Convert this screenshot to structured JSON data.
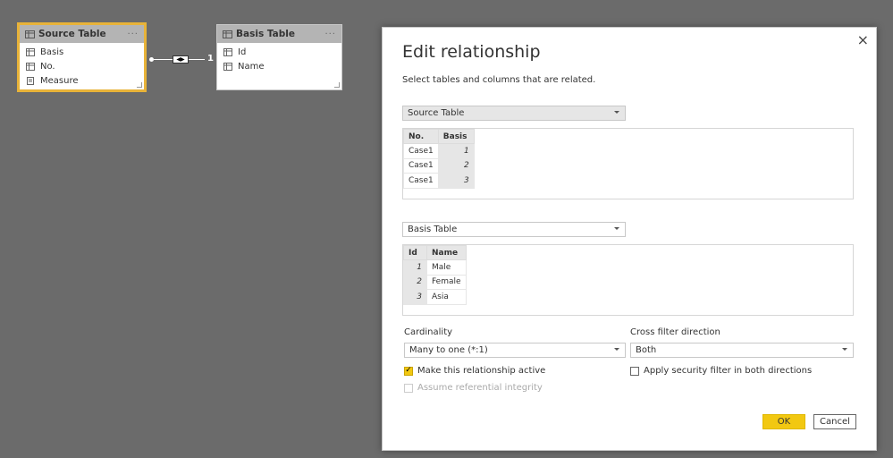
{
  "model": {
    "source_card": {
      "title": "Source Table",
      "more": "···",
      "fields": [
        {
          "label": "Basis",
          "icon": "column-icon"
        },
        {
          "label": "No.",
          "icon": "column-icon"
        },
        {
          "label": "Measure",
          "icon": "measure-icon"
        }
      ]
    },
    "basis_card": {
      "title": "Basis Table",
      "more": "···",
      "fields": [
        {
          "label": "Id",
          "icon": "column-icon"
        },
        {
          "label": "Name",
          "icon": "column-icon"
        }
      ]
    },
    "relationship": {
      "one_side_label": "1",
      "cross_filter_glyph": "◀▶"
    }
  },
  "dialog": {
    "title": "Edit relationship",
    "subtitle": "Select tables and columns that are related.",
    "close": "×",
    "table1": {
      "selected": "Source Table",
      "headers": [
        "No.",
        "Basis"
      ],
      "rows": [
        [
          "Case1",
          "1"
        ],
        [
          "Case1",
          "2"
        ],
        [
          "Case1",
          "3"
        ]
      ]
    },
    "table2": {
      "selected": "Basis Table",
      "headers": [
        "Id",
        "Name"
      ],
      "rows": [
        [
          "1",
          "Male"
        ],
        [
          "2",
          "Female"
        ],
        [
          "3",
          "Asia"
        ]
      ]
    },
    "cardinality": {
      "label": "Cardinality",
      "value": "Many to one (*:1)"
    },
    "cross_filter": {
      "label": "Cross filter direction",
      "value": "Both"
    },
    "make_active": {
      "label": "Make this relationship active",
      "checked": true
    },
    "referential_integrity": {
      "label": "Assume referential integrity",
      "checked": false,
      "disabled": true
    },
    "security_filter": {
      "label": "Apply security filter in both directions",
      "checked": false
    },
    "ok_label": "OK",
    "cancel_label": "Cancel"
  },
  "colors": {
    "canvas": "#6b6b6b",
    "accent": "#f2c811",
    "selected_border": "#e8b339",
    "header_grey": "#b4b4b4"
  }
}
